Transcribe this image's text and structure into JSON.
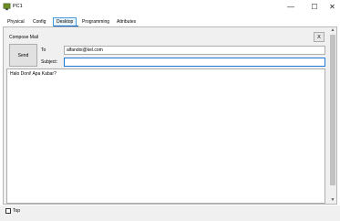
{
  "window": {
    "title": "PC1",
    "minimize_glyph": "—",
    "maximize_glyph": "☐",
    "close_glyph": "✕"
  },
  "tabs": [
    {
      "label": "Physical",
      "active": false
    },
    {
      "label": "Config",
      "active": false
    },
    {
      "label": "Desktop",
      "active": true
    },
    {
      "label": "Programming",
      "active": false
    },
    {
      "label": "Attributes",
      "active": false
    }
  ],
  "compose": {
    "heading": "Compose Mail",
    "close_label": "X",
    "send_label": "Send",
    "to_label": "To",
    "to_value": "alfandoi@kel.com",
    "subject_label": "Subject:",
    "subject_value": "",
    "body_text": "Halo Doni! Apa Kabar?"
  },
  "bottom": {
    "top_label": "Top",
    "top_checked": false
  },
  "colors": {
    "accent": "#0a64c8",
    "focus_border": "#1e7ad8"
  }
}
